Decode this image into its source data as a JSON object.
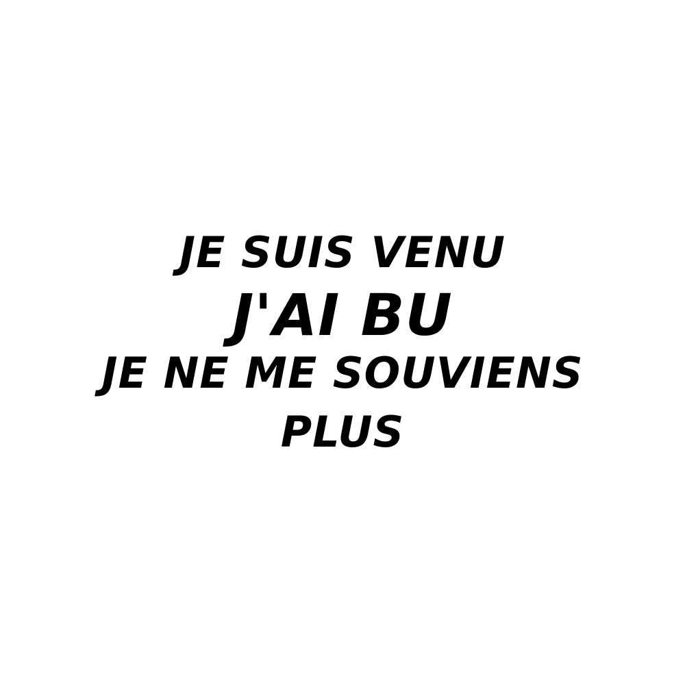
{
  "text": {
    "line1": "JE SUIS VENU",
    "line2": "J'AI BU",
    "line3": "JE NE ME SOUVIENS",
    "line4": "PLUS"
  },
  "colors": {
    "background": "#ffffff",
    "text": "#000000"
  }
}
